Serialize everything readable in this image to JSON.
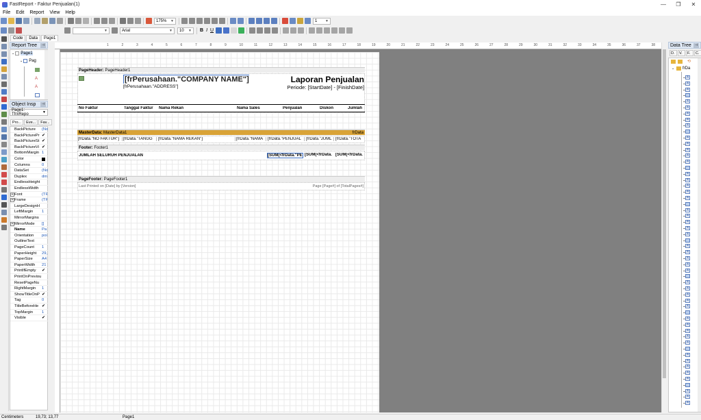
{
  "window": {
    "title": "FastReport - Faktur Penjualan(1)",
    "controls": [
      "—",
      "❐",
      "✕"
    ]
  },
  "menu": [
    "File",
    "Edit",
    "Report",
    "View",
    "Help"
  ],
  "toolbar": {
    "zoom": "175%",
    "font_name": "Arial",
    "font_size": "10",
    "bold": "B",
    "italic": "I",
    "underline": "U",
    "frame_width": "1"
  },
  "doc_tabs": [
    "Code",
    "Data",
    "Page1"
  ],
  "report_tree": {
    "title": "Report Tree",
    "items": [
      "Page1",
      "Pag"
    ]
  },
  "object_inspector": {
    "title": "Object Insp",
    "selected": "Page1: TfrxRepo",
    "tabs": [
      "Pro...",
      "Eve...",
      "Fav..."
    ],
    "properties": [
      {
        "name": "BackPicture",
        "value": "(No"
      },
      {
        "name": "BackPicturePr",
        "value": "✔"
      },
      {
        "name": "BackPictureSt",
        "value": "✔"
      },
      {
        "name": "BackPictureVi",
        "value": "✔"
      },
      {
        "name": "BottomMargin",
        "value": "1"
      },
      {
        "name": "Color",
        "value": ""
      },
      {
        "name": "Columns",
        "value": "0"
      },
      {
        "name": "DataSet",
        "value": "(No"
      },
      {
        "name": "Duplex",
        "value": "dm"
      },
      {
        "name": "EndlessHeight",
        "value": ""
      },
      {
        "name": "EndlessWidth",
        "value": ""
      },
      {
        "name": "Font",
        "value": "(TF"
      },
      {
        "name": "Frame",
        "value": "(TF"
      },
      {
        "name": "LargeDesignH",
        "value": ""
      },
      {
        "name": "LeftMargin",
        "value": "1"
      },
      {
        "name": "MirrorMargins",
        "value": ""
      },
      {
        "name": "MirrorMode",
        "value": "[]"
      },
      {
        "name": "Name",
        "value": "Pa"
      },
      {
        "name": "Orientation",
        "value": "poi"
      },
      {
        "name": "OutlineText",
        "value": ""
      },
      {
        "name": "PageCount",
        "value": "1"
      },
      {
        "name": "PaperHeight",
        "value": "29,"
      },
      {
        "name": "PaperSize",
        "value": "A4"
      },
      {
        "name": "PaperWidth",
        "value": "21"
      },
      {
        "name": "PrintIfEmpty",
        "value": "✔"
      },
      {
        "name": "PrintOnPreviou",
        "value": ""
      },
      {
        "name": "ResetPageNu",
        "value": ""
      },
      {
        "name": "RightMargin",
        "value": "1"
      },
      {
        "name": "ShowTitleOnP",
        "value": "✔"
      },
      {
        "name": "Tag",
        "value": "0"
      },
      {
        "name": "TitleBeforeHe",
        "value": "✔"
      },
      {
        "name": "TopMargin",
        "value": "1"
      },
      {
        "name": "Visible",
        "value": "✔"
      }
    ]
  },
  "ruler_numbers": [
    "1",
    "2",
    "3",
    "4",
    "5",
    "6",
    "7",
    "8",
    "9",
    "10",
    "11",
    "12",
    "13",
    "14",
    "15",
    "16",
    "17",
    "18",
    "19",
    "20",
    "21",
    "22",
    "23",
    "24",
    "25",
    "26",
    "27",
    "28",
    "29",
    "30",
    "31",
    "32",
    "33",
    "34",
    "35",
    "36",
    "37",
    "38"
  ],
  "report": {
    "page_header": {
      "label_type": "PageHeader:",
      "label_name": "PageHeader1",
      "company": "[frPerusahaan.\"COMPANY NAME\"]",
      "address": "[frPerusahaan.\"ADDRESS\"]",
      "report_title": "Laporan Penjualan",
      "period": "Periode: [StartDate] - [FinishDate]",
      "columns": [
        "No Faktur",
        "Tanggal Faktur",
        "Nama Rekan",
        "Nama Sales",
        "Penjualan",
        "Diskon",
        "Jumlah"
      ]
    },
    "master_data": {
      "label_type": "MasterData:",
      "label_name": "MasterData1",
      "dataset": "frData",
      "fields": [
        "[frData.\"NO FAKTUR\"]",
        "[frData.\"TANGG",
        "[frData.\"NAMA REKAN\"]",
        "[frData.\"NAMA",
        "[frData.\"PENJUAL",
        "[frData.\"JUML",
        "[frData.\"TOTA"
      ]
    },
    "footer": {
      "label_type": "Footer:",
      "label_name": "Footer1",
      "total_label": "JUMLAH SELURUH PENJUALAN",
      "sums": [
        "[SUM(<frData.\"PE",
        "[SUM(<frData.",
        "[SUM(<frData."
      ]
    },
    "page_footer": {
      "label_type": "PageFooter:",
      "label_name": "PageFooter1",
      "printed_on": "Last Printed on [Date] by [Version]",
      "page_info": "Page [Page#] of [TotalPages#]"
    }
  },
  "data_tree": {
    "title": "Data Tree",
    "tabs": [
      "D.",
      "V.",
      "F.",
      "C."
    ],
    "root": "frDa",
    "item_count": 55
  },
  "status": {
    "units": "Centimeters",
    "coords": "19,73; 13,77",
    "page": "Page1"
  }
}
